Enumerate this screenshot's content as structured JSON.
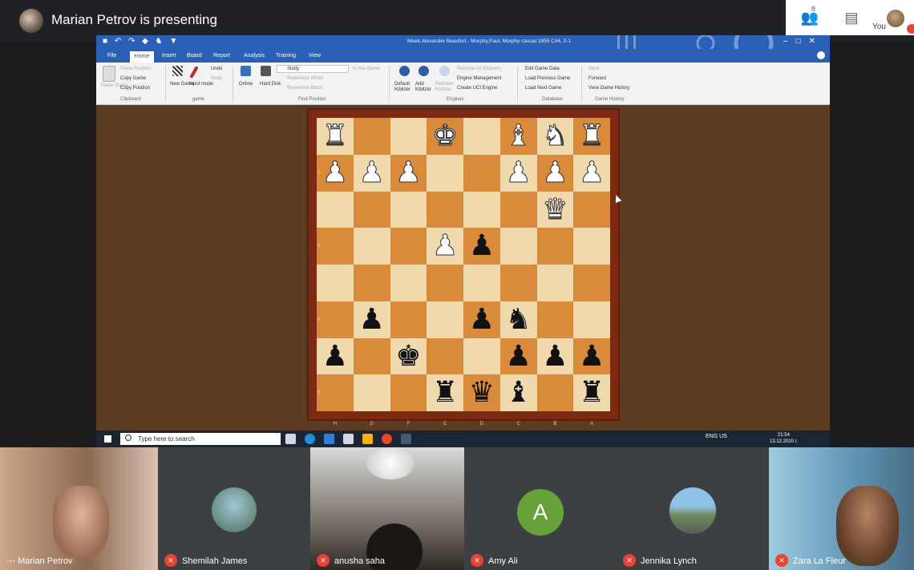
{
  "meet": {
    "presenting_text": "Marian Petrov is presenting",
    "people_count": "8",
    "you_label": "You"
  },
  "app": {
    "window_title": "Meek,Alexander Beaufort - Morphy,Paul, Morphy casual 1855  C44, 0-1",
    "menu": [
      "File",
      "Home",
      "Insert",
      "Board",
      "Report",
      "Analysis",
      "Training",
      "View"
    ],
    "ribbon": {
      "clipboard": {
        "paste": "Paste Game",
        "paste_position": "Paste Position",
        "copy_game": "Copy Game",
        "copy_position": "Copy Position",
        "group": "Clipboard"
      },
      "game": {
        "new_game": "New Game",
        "input_mode": "Input mode",
        "undo": "Undo",
        "redo": "Redo",
        "group": "game"
      },
      "find_position": {
        "online": "Online",
        "hard_disk": "Hard Disk",
        "study": "Study",
        "in_this_game": "In this Game",
        "repertoire_white": "Repertoire White",
        "repertoire_black": "Repertoire Black",
        "group": "Find Position"
      },
      "engines": {
        "default_kibitzer": "Default Kibitzer",
        "add_kibitzer": "Add Kibitzer",
        "remove_kibitzer": "Remove Kibitzer",
        "remove_all": "Remove All Kibitzers",
        "engine_management": "Engine Management",
        "create_uci": "Create UCI Engine",
        "group": "Engines"
      },
      "database": {
        "edit_game_data": "Edit Game Data",
        "load_previous": "Load Previous Game",
        "load_next": "Load Next Game",
        "group": "Database"
      },
      "game_history": {
        "back": "Back",
        "forward": "Forward",
        "view_history": "View Game History",
        "group": "Game History"
      }
    },
    "board": {
      "files": [
        "H",
        "G",
        "F",
        "E",
        "D",
        "C",
        "B",
        "A"
      ],
      "ranks": [
        "1",
        "2",
        "3",
        "4",
        "5",
        "6",
        "7",
        "8"
      ]
    },
    "taskbar": {
      "search_placeholder": "Type here to search",
      "tray": "ENG US",
      "time": "21:54",
      "date": "13.12.2020 г."
    }
  },
  "participants": [
    {
      "name": "Marian Petrov",
      "muted": false
    },
    {
      "name": "Shemilah James",
      "muted": true
    },
    {
      "name": "anusha saha",
      "muted": true
    },
    {
      "name": "Amy Ali",
      "muted": true,
      "initial": "A"
    },
    {
      "name": "Jennika Lynch",
      "muted": true
    },
    {
      "name": "Zara La Fleur",
      "muted": true
    }
  ]
}
